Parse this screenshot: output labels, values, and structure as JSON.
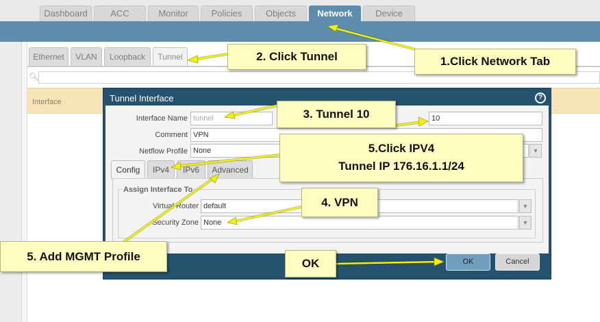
{
  "top_tabs": [
    "Dashboard",
    "ACC",
    "Monitor",
    "Policies",
    "Objects",
    "Network",
    "Device"
  ],
  "sub_tabs": [
    "Ethernet",
    "VLAN",
    "Loopback",
    "Tunnel"
  ],
  "table": {
    "interface_header": "Interface"
  },
  "dialog": {
    "title": "Tunnel Interface",
    "help_glyph": "?",
    "fields": {
      "interface_name_label": "Interface Name",
      "interface_name_placeholder": "tunnel",
      "interface_number": "10",
      "comment_label": "Comment",
      "comment_value": "VPN",
      "netflow_label": "Netflow Profile",
      "netflow_value": "None"
    },
    "tabs": [
      "Config",
      "IPv4",
      "IPv6",
      "Advanced"
    ],
    "assign_legend": "Assign Interface To",
    "virtual_router_label": "Virtual Router",
    "virtual_router_value": "default",
    "security_zone_label": "Security Zone",
    "security_zone_value": "None",
    "ok_label": "OK",
    "cancel_label": "Cancel"
  },
  "callouts": {
    "network_tab": "1.Click Network Tab",
    "tunnel": "2. Click Tunnel",
    "tunnel10": "3. Tunnel 10",
    "ipv4_line1": "5.Click IPV4",
    "ipv4_line2": "Tunnel IP 176.16.1.1/24",
    "vpn": "4. VPN",
    "mgmt": "5. Add MGMT Profile",
    "ok": "OK"
  },
  "colors": {
    "nav_blue": "#5d8cac",
    "dialog_blue": "#25536f",
    "callout_yellow": "#ffffc1",
    "arrow_yellow": "#f2f200",
    "row_highlight": "#f6e4b6"
  }
}
